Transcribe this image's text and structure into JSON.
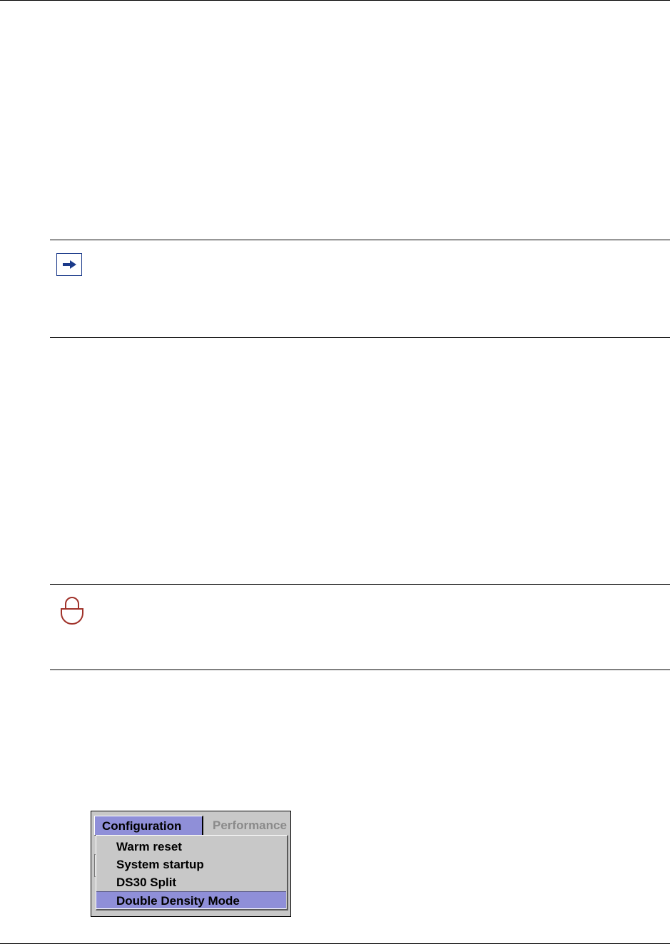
{
  "note_icon": {
    "name": "arrow-right-icon",
    "color": "#1b3a8a"
  },
  "security_icon": {
    "name": "lock-icon",
    "color": "#a0322a"
  },
  "menu_screenshot": {
    "menubar": {
      "active_tab": "Configuration",
      "inactive_tab": "Performance"
    },
    "items": [
      "Warm reset",
      "System startup",
      "DS30 Split",
      "Double Density Mode"
    ],
    "selected_item": "Double Density Mode",
    "highlight_color": "#8f8fd8"
  }
}
